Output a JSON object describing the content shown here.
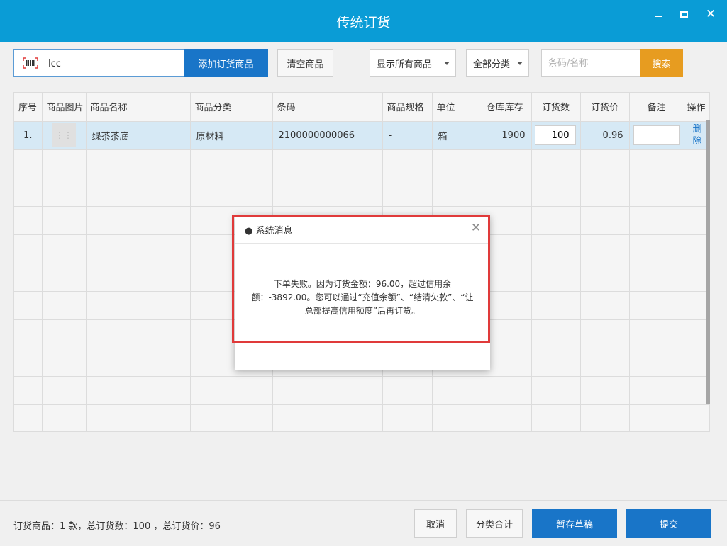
{
  "window": {
    "title": "传统订货",
    "close_glyph": "✕"
  },
  "toolbar": {
    "scan_value": "lcc",
    "add_label": "添加订货商品",
    "clear_label": "清空商品",
    "show_select": "显示所有商品",
    "category_select": "全部分类",
    "search_placeholder": "条码/名称",
    "search_label": "搜索"
  },
  "table": {
    "headers": [
      "序号",
      "商品图片",
      "商品名称",
      "商品分类",
      "条码",
      "商品规格",
      "单位",
      "仓库库存",
      "订货数",
      "订货价",
      "备注",
      "操作"
    ],
    "rows": [
      {
        "index": "1.",
        "name": "绿茶茶底",
        "category": "原材料",
        "barcode": "2100000000066",
        "spec": "-",
        "unit": "箱",
        "stock": "1900",
        "qty": "100",
        "price": "0.96",
        "note": "",
        "action": "删除"
      }
    ]
  },
  "footer": {
    "summary": "订货商品：1 款，总订货数：100 ，总订货价：96",
    "cancel_label": "取消",
    "category_sum_label": "分类合计",
    "draft_label": "暂存草稿",
    "submit_label": "提交"
  },
  "dialog": {
    "title": "● 系统消息",
    "close_glyph": "✕",
    "message": "下单失败。因为订货金额：96.00，超过信用余额：-3892.00。您可以通过“充值余额”、“结清欠款”、“让总部提高信用额度”后再订货。"
  },
  "colors": {
    "titlebar": "#0a9cd6",
    "primary": "#1975c8",
    "search": "#e79c20",
    "highlight": "#e03a3a",
    "selected_row": "#d6e9f5"
  }
}
